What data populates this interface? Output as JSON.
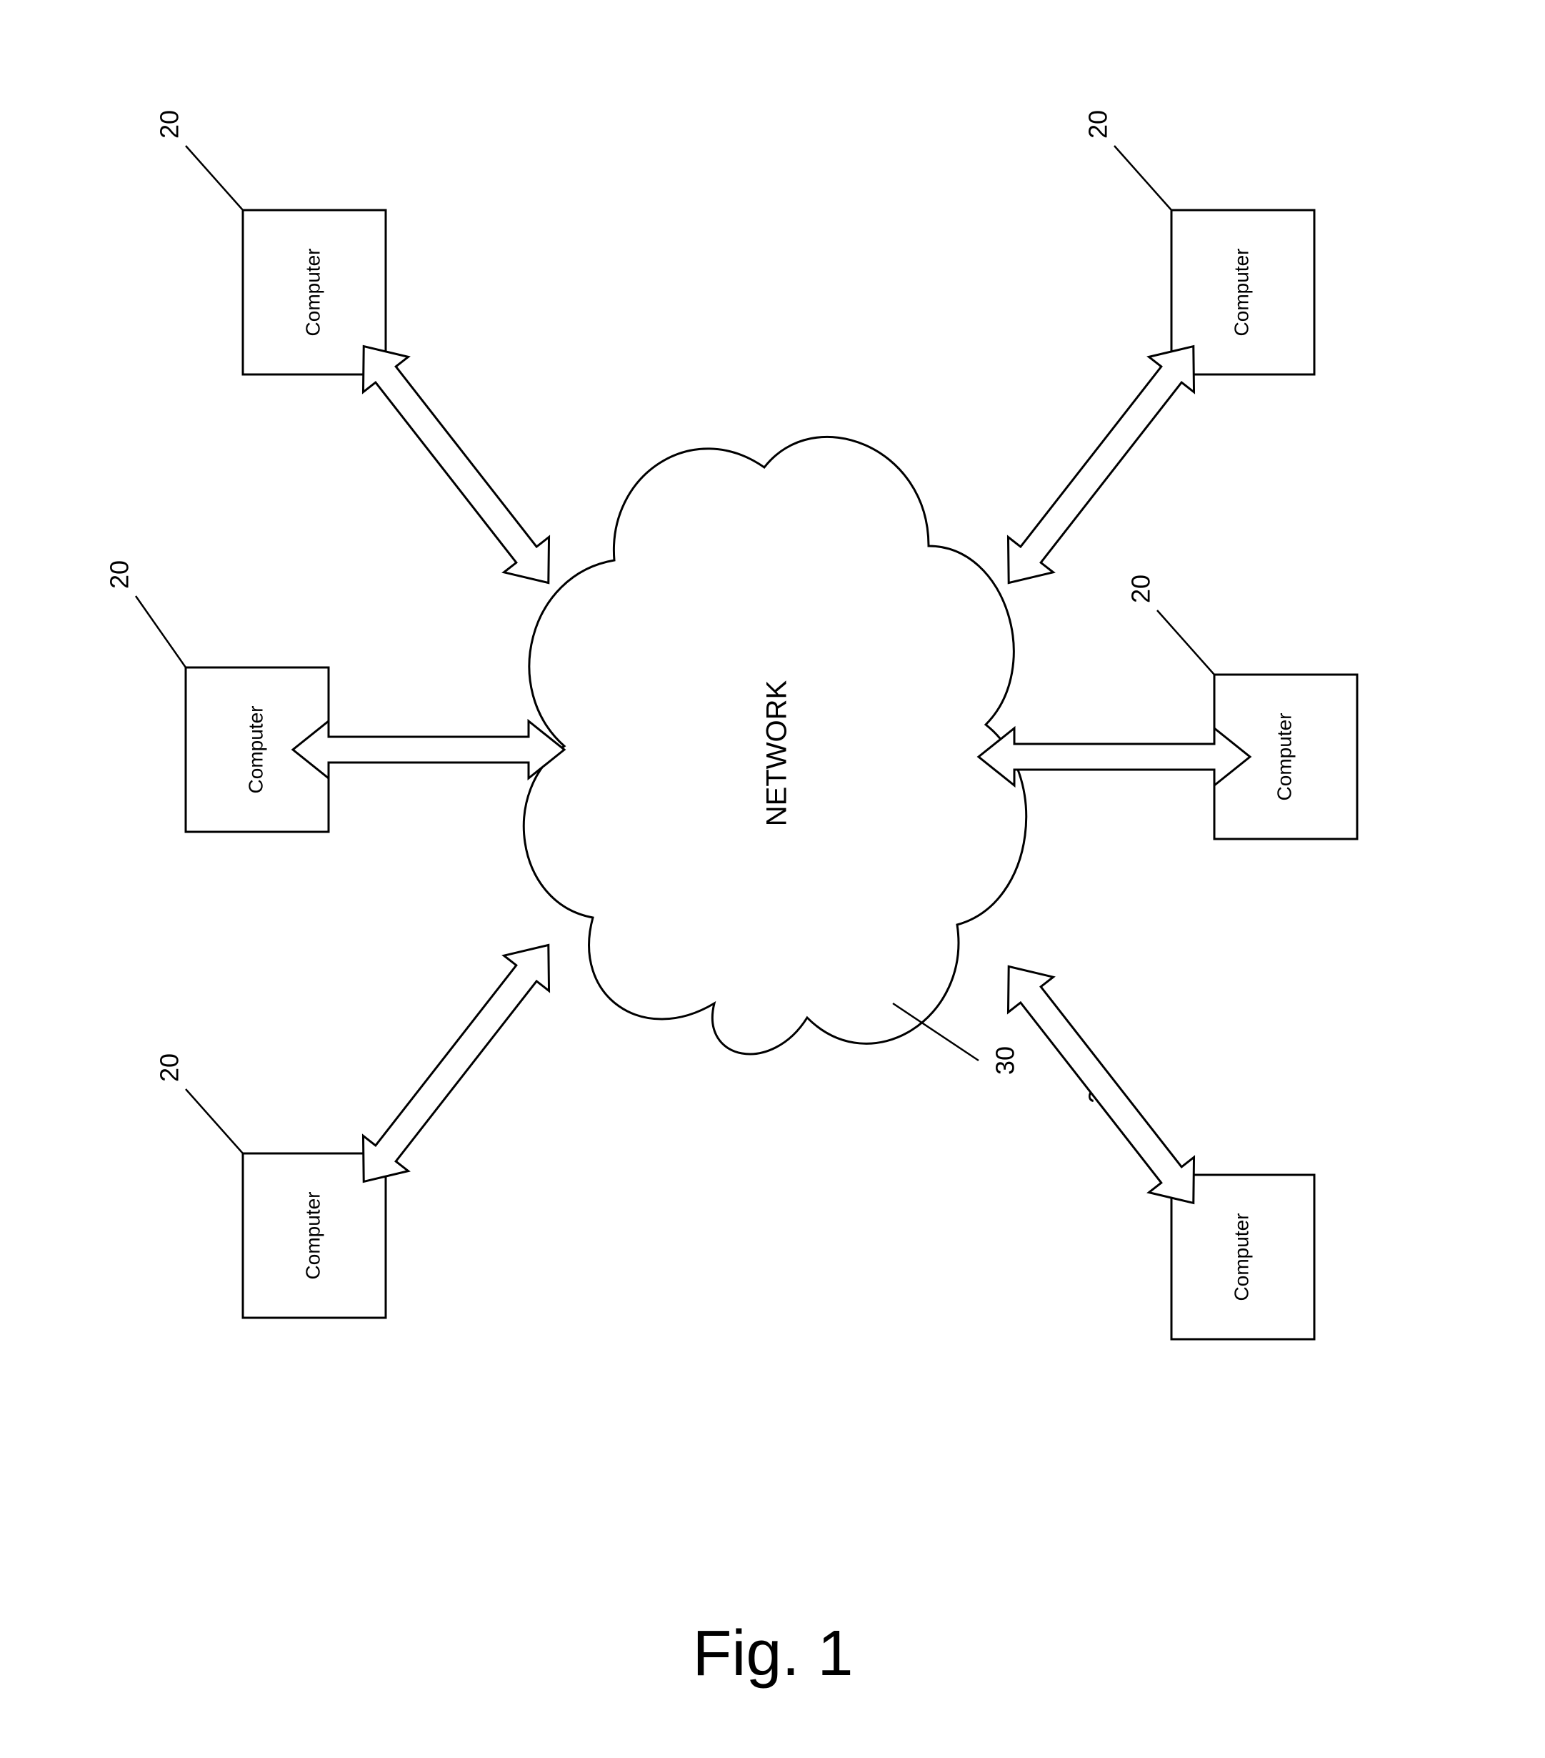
{
  "cloud": {
    "label": "NETWORK",
    "ref": "30"
  },
  "nodes": {
    "top_left": {
      "label": "Computer",
      "ref": "20"
    },
    "top_center": {
      "label": "Computer",
      "ref": "20"
    },
    "top_right": {
      "label": "Computer",
      "ref": "20"
    },
    "bottom_left": {
      "label": "Computer",
      "ref": "20"
    },
    "bottom_center": {
      "label": "Computer",
      "ref": "20"
    },
    "bottom_right": {
      "label": "Computer",
      "ref": "20"
    }
  },
  "caption": "Fig. 1"
}
